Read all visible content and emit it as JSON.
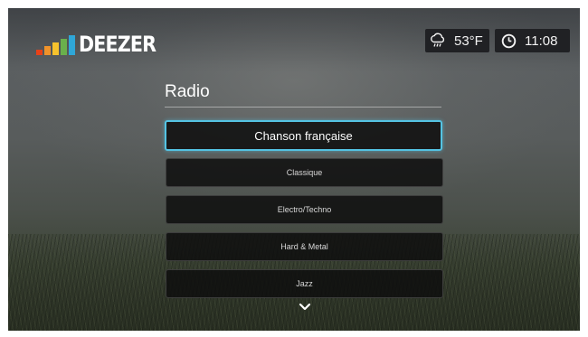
{
  "app": {
    "logo_text": "DEEZER",
    "logo_bar_colors": [
      "#e84118",
      "#f0932b",
      "#f6c22d",
      "#6ab04c",
      "#2fa7d8"
    ]
  },
  "status": {
    "weather_icon": "cloud-rain-icon",
    "temperature": "53°F",
    "clock_icon": "clock-icon",
    "time": "11:08"
  },
  "section": {
    "title": "Radio"
  },
  "radio_list": {
    "items": [
      {
        "label": "Chanson française",
        "selected": true
      },
      {
        "label": "Classique",
        "selected": false
      },
      {
        "label": "Electro/Techno",
        "selected": false
      },
      {
        "label": "Hard & Metal",
        "selected": false
      },
      {
        "label": "Jazz",
        "selected": false
      }
    ],
    "more_icon": "chevron-down-icon"
  },
  "colors": {
    "focus": "#54c3e3",
    "badge_bg": "#202124"
  }
}
